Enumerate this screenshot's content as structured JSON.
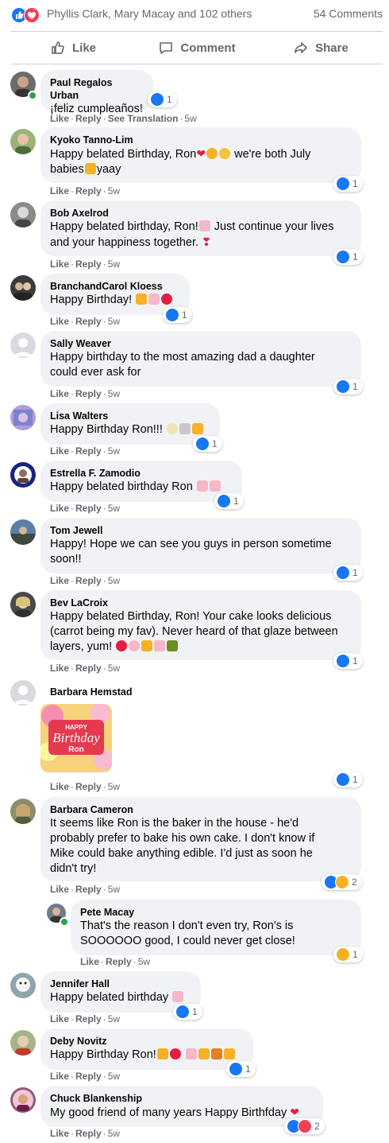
{
  "header": {
    "reactors": "Phyllis Clark, Mary Macay and 102 others",
    "comments_count": "54 Comments"
  },
  "actions": {
    "like": "Like",
    "comment": "Comment",
    "share": "Share"
  },
  "meta_labels": {
    "like": "Like",
    "reply": "Reply",
    "see_translation": "See Translation",
    "dot": "·"
  },
  "colors": {
    "like_blue": "#1877f2",
    "love_red": "#f33e58",
    "haha_yellow": "#f7b125",
    "online_green": "#31a24c"
  },
  "comments": [
    {
      "author": "Paul Regalos Urban",
      "text": "¡feliz cumpleaños!",
      "time": "5w",
      "reactions": [
        "like"
      ],
      "count": "1"
    },
    {
      "author": "Kyoko Tanno-Lim",
      "text1": "Happy belated Birthday, Ron",
      "text1b": " we're both July",
      "text2": "babies",
      "text2b": "yaay",
      "time": "5w",
      "reactions": [
        "like"
      ],
      "count": "1"
    },
    {
      "author": "Bob Axelrod",
      "text1": "Happy belated birthday, Ron!",
      "text1b": " Just continue your lives",
      "text2": "and your happiness together. ",
      "time": "5w",
      "reactions": [
        "like"
      ],
      "count": "1"
    },
    {
      "author": "BranchandCarol Kloess",
      "text": "Happy Birthday! ",
      "time": "5w",
      "reactions": [
        "like"
      ],
      "count": "1"
    },
    {
      "author": "Sally Weaver",
      "text1": "Happy birthday to the most amazing dad a daughter",
      "text2": "could ever ask for",
      "time": "5w",
      "reactions": [
        "like"
      ],
      "count": "1"
    },
    {
      "author": "Lisa Walters",
      "text": "Happy Birthday Ron!!! ",
      "time": "5w",
      "reactions": [
        "like"
      ],
      "count": "1"
    },
    {
      "author": "Estrella F. Zamodio",
      "text": "Happy belated birthday Ron ",
      "time": "5w",
      "reactions": [
        "like"
      ],
      "count": "1"
    },
    {
      "author": "Tom Jewell",
      "text1": "Happy! Hope we can see you guys in person sometime",
      "text2": "soon!!",
      "time": "5w",
      "reactions": [
        "like"
      ],
      "count": "1"
    },
    {
      "author": "Bev LaCroix",
      "text1": "Happy belated Birthday, Ron! Your cake looks delicious",
      "text2": "(carrot being my fav). Never heard of that glaze between",
      "text3": "layers, yum! ",
      "time": "5w",
      "reactions": [
        "like"
      ],
      "count": "1"
    },
    {
      "author": "Barbara Hemstad",
      "gif_line1": "HAPPY",
      "gif_line2": "Birthday",
      "gif_line3": "Ron",
      "time": "5w",
      "reactions": [
        "like"
      ],
      "count": "1"
    },
    {
      "author": "Barbara Cameron",
      "text1": "It seems like Ron is the baker in the house - he'd",
      "text2": "probably prefer to bake his own cake. I don't know if",
      "text3": "Mike could bake anything edible. I'd just as soon he",
      "text4": "didn't try!",
      "time": "5w",
      "reactions": [
        "like",
        "haha"
      ],
      "count": "2"
    },
    {
      "author": "Pete Macay",
      "text1": "That's the reason I don't even try, Ron's is",
      "text2": "SOOOOOO good, I could never get close!",
      "time": "5w",
      "reactions": [
        "haha"
      ],
      "count": "1"
    },
    {
      "author": "Jennifer Hall",
      "text": "Happy belated birthday ",
      "time": "5w",
      "reactions": [
        "like"
      ],
      "count": "1"
    },
    {
      "author": "Deby Novitz",
      "text": "Happy Birthday Ron!",
      "time": "5w",
      "reactions": [
        "like"
      ],
      "count": "1"
    },
    {
      "author": "Chuck Blankenship",
      "text": "My good friend of many years Happy Birthfday ",
      "time": "5w",
      "reactions": [
        "like",
        "love"
      ],
      "count": "2"
    }
  ]
}
